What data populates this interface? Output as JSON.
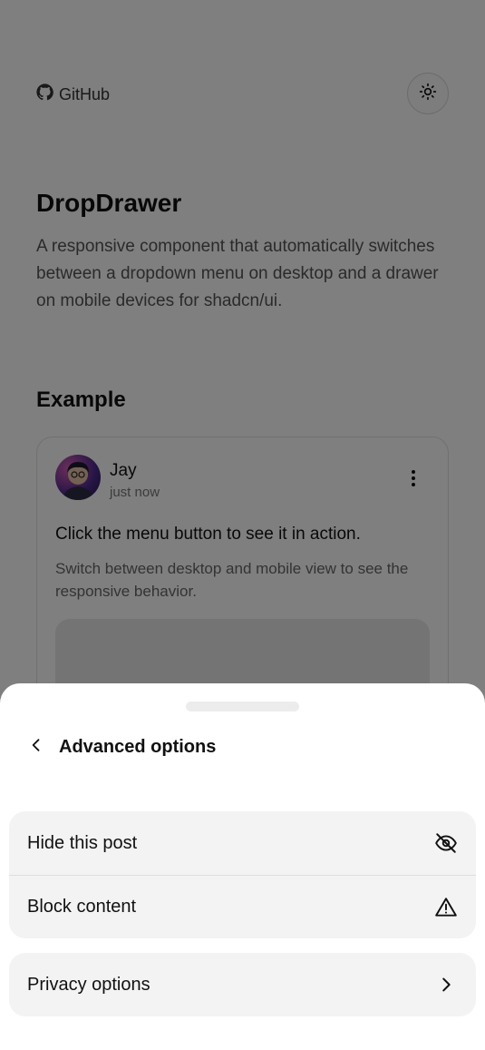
{
  "header": {
    "github_label": "GitHub",
    "theme_icon": "sun-icon"
  },
  "hero": {
    "title": "DropDrawer",
    "description": "A responsive component that automatically switches between a dropdown menu on desktop and a drawer on mobile devices for shadcn/ui."
  },
  "example": {
    "section_title": "Example",
    "post": {
      "author": "Jay",
      "time": "just now",
      "heading": "Click the menu button to see it in action.",
      "text": "Switch between desktop and mobile view to see the responsive behavior."
    }
  },
  "drawer": {
    "title": "Advanced options",
    "back_icon": "chevron-left-icon",
    "items": [
      {
        "label": "Hide this post",
        "icon": "eye-off-icon"
      },
      {
        "label": "Block content",
        "icon": "alert-triangle-icon"
      },
      {
        "label": "Privacy options",
        "icon": "chevron-right-icon"
      }
    ]
  }
}
